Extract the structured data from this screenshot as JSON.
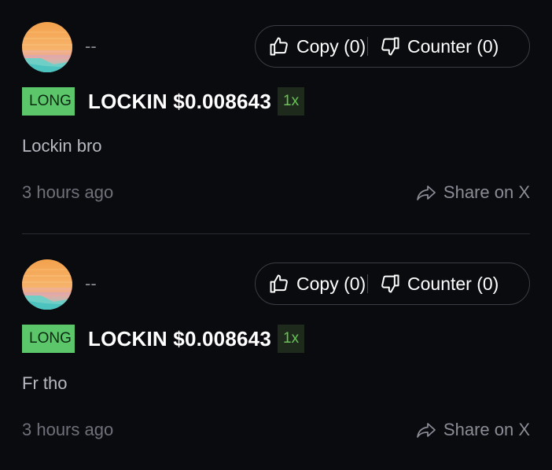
{
  "colors": {
    "background": "#0a0b0f",
    "long_badge": "#5cc66b",
    "leverage_text": "#6cc25a",
    "divider": "#2a2c33"
  },
  "posts": [
    {
      "username": "--",
      "copy_label": "Copy (0)",
      "counter_label": "Counter (0)",
      "side": "LONG",
      "trade": "LOCKIN $0.008643",
      "leverage": "1x",
      "message": "Lockin bro",
      "timestamp": "3 hours ago",
      "share_label": "Share on X",
      "icons": {
        "copy": "thumbs-up-icon",
        "counter": "thumbs-down-icon",
        "share": "share-arrow-icon"
      }
    },
    {
      "username": "--",
      "copy_label": "Copy (0)",
      "counter_label": "Counter (0)",
      "side": "LONG",
      "trade": "LOCKIN $0.008643",
      "leverage": "1x",
      "message": "Fr tho",
      "timestamp": "3 hours ago",
      "share_label": "Share on X",
      "icons": {
        "copy": "thumbs-up-icon",
        "counter": "thumbs-down-icon",
        "share": "share-arrow-icon"
      }
    }
  ]
}
